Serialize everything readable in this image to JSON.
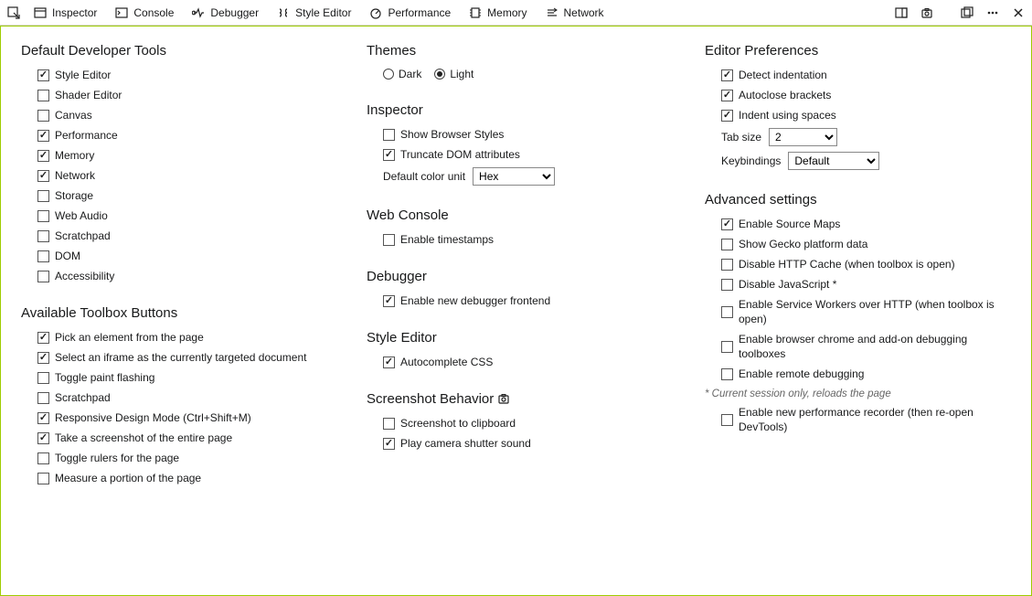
{
  "toolbar": {
    "tabs": [
      {
        "label": "Inspector",
        "icon": "inspector"
      },
      {
        "label": "Console",
        "icon": "console"
      },
      {
        "label": "Debugger",
        "icon": "debugger"
      },
      {
        "label": "Style Editor",
        "icon": "style"
      },
      {
        "label": "Performance",
        "icon": "perf"
      },
      {
        "label": "Memory",
        "icon": "memory"
      },
      {
        "label": "Network",
        "icon": "network"
      }
    ]
  },
  "col1": {
    "h1": "Default Developer Tools",
    "tools": [
      {
        "label": "Style Editor",
        "checked": true
      },
      {
        "label": "Shader Editor",
        "checked": false
      },
      {
        "label": "Canvas",
        "checked": false
      },
      {
        "label": "Performance",
        "checked": true
      },
      {
        "label": "Memory",
        "checked": true
      },
      {
        "label": "Network",
        "checked": true
      },
      {
        "label": "Storage",
        "checked": false
      },
      {
        "label": "Web Audio",
        "checked": false
      },
      {
        "label": "Scratchpad",
        "checked": false
      },
      {
        "label": "DOM",
        "checked": false
      },
      {
        "label": "Accessibility",
        "checked": false
      }
    ],
    "h2": "Available Toolbox Buttons",
    "buttons": [
      {
        "label": "Pick an element from the page",
        "checked": true
      },
      {
        "label": "Select an iframe as the currently targeted document",
        "checked": true
      },
      {
        "label": "Toggle paint flashing",
        "checked": false
      },
      {
        "label": "Scratchpad",
        "checked": false
      },
      {
        "label": "Responsive Design Mode (Ctrl+Shift+M)",
        "checked": true
      },
      {
        "label": "Take a screenshot of the entire page",
        "checked": true
      },
      {
        "label": "Toggle rulers for the page",
        "checked": false
      },
      {
        "label": "Measure a portion of the page",
        "checked": false
      }
    ]
  },
  "col2": {
    "h_themes": "Themes",
    "theme_dark": "Dark",
    "theme_light": "Light",
    "theme_selected": "light",
    "h_inspector": "Inspector",
    "inspector": [
      {
        "label": "Show Browser Styles",
        "checked": false
      },
      {
        "label": "Truncate DOM attributes",
        "checked": true
      }
    ],
    "color_unit_label": "Default color unit",
    "color_unit_value": "Hex",
    "h_console": "Web Console",
    "console": [
      {
        "label": "Enable timestamps",
        "checked": false
      }
    ],
    "h_debugger": "Debugger",
    "debugger": [
      {
        "label": "Enable new debugger frontend",
        "checked": true
      }
    ],
    "h_style": "Style Editor",
    "style": [
      {
        "label": "Autocomplete CSS",
        "checked": true
      }
    ],
    "h_screenshot": "Screenshot Behavior",
    "screenshot": [
      {
        "label": "Screenshot to clipboard",
        "checked": false
      },
      {
        "label": "Play camera shutter sound",
        "checked": true
      }
    ]
  },
  "col3": {
    "h_editor": "Editor Preferences",
    "editor": [
      {
        "label": "Detect indentation",
        "checked": true
      },
      {
        "label": "Autoclose brackets",
        "checked": true
      },
      {
        "label": "Indent using spaces",
        "checked": true
      }
    ],
    "tab_size_label": "Tab size",
    "tab_size_value": "2",
    "keybindings_label": "Keybindings",
    "keybindings_value": "Default",
    "h_advanced": "Advanced settings",
    "advanced": [
      {
        "label": "Enable Source Maps",
        "checked": true
      },
      {
        "label": "Show Gecko platform data",
        "checked": false
      },
      {
        "label": "Disable HTTP Cache (when toolbox is open)",
        "checked": false
      },
      {
        "label": "Disable JavaScript *",
        "checked": false
      },
      {
        "label": "Enable Service Workers over HTTP (when toolbox is open)",
        "checked": false
      },
      {
        "label": "Enable browser chrome and add-on debugging toolboxes",
        "checked": false
      },
      {
        "label": "Enable remote debugging",
        "checked": false
      }
    ],
    "footnote": "* Current session only, reloads the page",
    "perf_recorder": {
      "label": "Enable new performance recorder (then re-open DevTools)",
      "checked": false
    }
  }
}
